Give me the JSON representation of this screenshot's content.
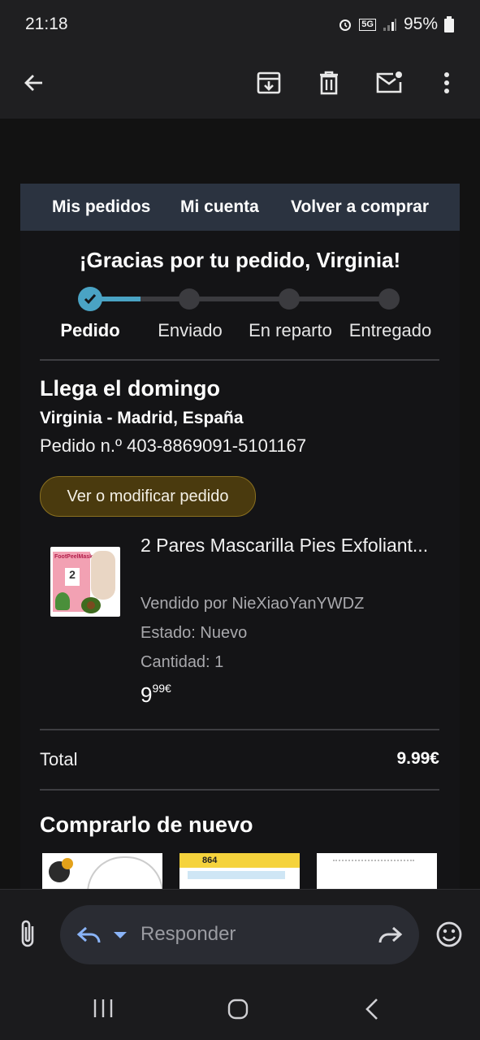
{
  "status": {
    "time": "21:18",
    "network": "5G",
    "battery": "95%"
  },
  "toolbar": {
    "icons": [
      "back-arrow-icon",
      "archive-icon",
      "delete-icon",
      "mark-unread-icon",
      "more-vert-icon"
    ]
  },
  "email": {
    "nav": {
      "orders": "Mis pedidos",
      "account": "Mi cuenta",
      "buy_again": "Volver a comprar"
    },
    "thanks": "¡Gracias por tu pedido, Virginia!",
    "steps": [
      {
        "label": "Pedido",
        "done": true
      },
      {
        "label": "Enviado",
        "done": false
      },
      {
        "label": "En reparto",
        "done": false
      },
      {
        "label": "Entregado",
        "done": false
      }
    ],
    "arrival": "Llega el domingo",
    "address": "Virginia - Madrid, España",
    "order_number": "Pedido n.º 403-8869091-5101167",
    "view_button": "Ver o modificar pedido",
    "product": {
      "title": "2 Pares Mascarilla Pies Exfoliant...",
      "seller": "Vendido por NieXiaoYanYWDZ",
      "condition": "Estado: Nuevo",
      "quantity": "Cantidad: 1",
      "price_whole": "9",
      "price_cents": "99€",
      "thumb_text": "FootPeelMask"
    },
    "total_label": "Total",
    "total_value": "9.99€",
    "buy_again_title": "Comprarlo de nuevo",
    "buy_again_item_text": "864"
  },
  "reply": {
    "placeholder": "Responder"
  },
  "colors": {
    "accent": "#4aa3c4",
    "button_bg": "#4a3a0e",
    "nav_bg": "#2b3340"
  }
}
